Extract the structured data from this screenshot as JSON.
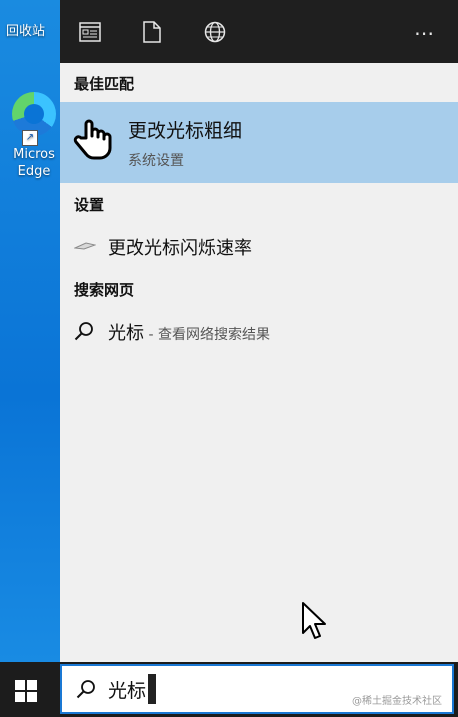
{
  "desktop": {
    "recycle_label": "回收站",
    "edge_label_1": "Micros",
    "edge_label_2": "Edge"
  },
  "topbar": {
    "icons": [
      "apps-icon",
      "document-icon",
      "web-icon"
    ],
    "more_label": "⋯"
  },
  "sections": {
    "best_match": "最佳匹配",
    "settings": "设置",
    "search_web": "搜索网页"
  },
  "best_match": {
    "title": "更改光标粗细",
    "subtitle": "系统设置"
  },
  "settings_items": [
    {
      "label": "更改光标闪烁速率"
    }
  ],
  "web_items": [
    {
      "query": "光标",
      "hint": " - 查看网络搜索结果"
    }
  ],
  "searchbox": {
    "value": "光标"
  },
  "watermark": "@稀土掘金技术社区",
  "colors": {
    "panel_bg": "#f0f0f0",
    "topbar_bg": "#1f1f1f",
    "selected_bg": "#a7cdeb",
    "accent": "#1a78d4"
  }
}
